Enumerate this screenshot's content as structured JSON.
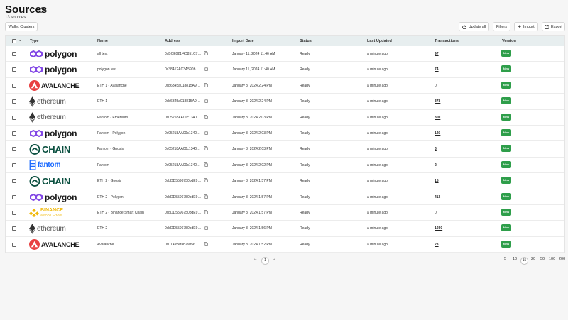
{
  "header": {
    "title": "Sources",
    "count": "13 sources"
  },
  "toolbar": {
    "wallet_clusters": "Wallet Clusters",
    "update_all": "Update all",
    "filters": "Filters",
    "import": "Import",
    "export": "Export"
  },
  "table": {
    "columns": [
      "Type",
      "Name",
      "Address",
      "Import Date",
      "Status",
      "Last Updated",
      "Transactions",
      "Version"
    ],
    "rows": [
      {
        "type": "polygon",
        "name": "all test",
        "address": "0xBCE021f4D851C7…",
        "import_date": "January 11, 2024 11:46 AM",
        "status": "Ready",
        "last_updated": "a minute ago",
        "transactions": "97",
        "version": "New"
      },
      {
        "type": "polygon",
        "name": "polygon test",
        "address": "0x38412AC3A590b…",
        "import_date": "January 11, 2024 11:40 AM",
        "status": "Ready",
        "last_updated": "a minute ago",
        "transactions": "74",
        "version": "New"
      },
      {
        "type": "avalanche",
        "name": "ETH 1 - Avalanche",
        "address": "0xb6345a018815A9…",
        "import_date": "January 3, 2024 2:24 PM",
        "status": "Ready",
        "last_updated": "a minute ago",
        "transactions": "0",
        "version": "New"
      },
      {
        "type": "ethereum",
        "name": "ETH 1",
        "address": "0xb6345a018815A9…",
        "import_date": "January 3, 2024 2:24 PM",
        "status": "Ready",
        "last_updated": "a minute ago",
        "transactions": "378",
        "version": "New"
      },
      {
        "type": "ethereum",
        "name": "Fantom - Ethereum",
        "address": "0x05218AA00c1340…",
        "import_date": "January 3, 2024 2:03 PM",
        "status": "Ready",
        "last_updated": "a minute ago",
        "transactions": "300",
        "version": "New"
      },
      {
        "type": "polygon",
        "name": "Fantom - Polygon",
        "address": "0x05218AA00c1340…",
        "import_date": "January 3, 2024 2:03 PM",
        "status": "Ready",
        "last_updated": "a minute ago",
        "transactions": "126",
        "version": "New"
      },
      {
        "type": "chain",
        "name": "Fantom - Gnosis",
        "address": "0x05218AA00c1340…",
        "import_date": "January 3, 2024 2:03 PM",
        "status": "Ready",
        "last_updated": "a minute ago",
        "transactions": "3",
        "version": "New"
      },
      {
        "type": "fantom",
        "name": "Fantom",
        "address": "0x05218AA00c1340…",
        "import_date": "January 3, 2024 2:02 PM",
        "status": "Ready",
        "last_updated": "a minute ago",
        "transactions": "2",
        "version": "New"
      },
      {
        "type": "chain",
        "name": "ETH 2 - Gnosis",
        "address": "0xbDD5596750bdE9…",
        "import_date": "January 3, 2024 1:57 PM",
        "status": "Ready",
        "last_updated": "a minute ago",
        "transactions": "15",
        "version": "New"
      },
      {
        "type": "polygon",
        "name": "ETH 2 - Polygon",
        "address": "0xbDD5596750bdE9…",
        "import_date": "January 3, 2024 1:57 PM",
        "status": "Ready",
        "last_updated": "a minute ago",
        "transactions": "413",
        "version": "New"
      },
      {
        "type": "binance",
        "name": "ETH 2 - Binance Smart Chain",
        "address": "0xbDD5596750bdE9…",
        "import_date": "January 3, 2024 1:57 PM",
        "status": "Ready",
        "last_updated": "a minute ago",
        "transactions": "0",
        "version": "New"
      },
      {
        "type": "ethereum",
        "name": "ETH 2",
        "address": "0xbDD5596750bdE9…",
        "import_date": "January 3, 2024 1:56 PM",
        "status": "Ready",
        "last_updated": "a minute ago",
        "transactions": "1930",
        "version": "New"
      },
      {
        "type": "avalanche",
        "name": "Avalanche",
        "address": "0x01495efab29b56…",
        "import_date": "January 3, 2024 1:52 PM",
        "status": "Ready",
        "last_updated": "a minute ago",
        "transactions": "23",
        "version": "New"
      }
    ]
  },
  "logos": {
    "polygon": {
      "text": "polygon",
      "color": "#8247e5"
    },
    "avalanche": {
      "text": "AVALANCHE",
      "color": "#e84142"
    },
    "ethereum": {
      "text": "ethereum",
      "color": "#555555"
    },
    "chain": {
      "text": "CHAIN",
      "color": "#0b5040"
    },
    "fantom": {
      "text": "fantom",
      "color": "#1969ff"
    },
    "binance": {
      "text": "BINANCE",
      "subtext": "SMART CHAIN",
      "color": "#f0b90b"
    }
  },
  "pagination": {
    "current": "1",
    "prev_icon": "←",
    "next_icon": "→",
    "sizes": [
      "5",
      "10",
      "15",
      "20",
      "50",
      "100",
      "200"
    ],
    "selected_size": "15"
  },
  "colors": {
    "badge": "#2e9e4a",
    "header_row": "#e7eeef"
  }
}
